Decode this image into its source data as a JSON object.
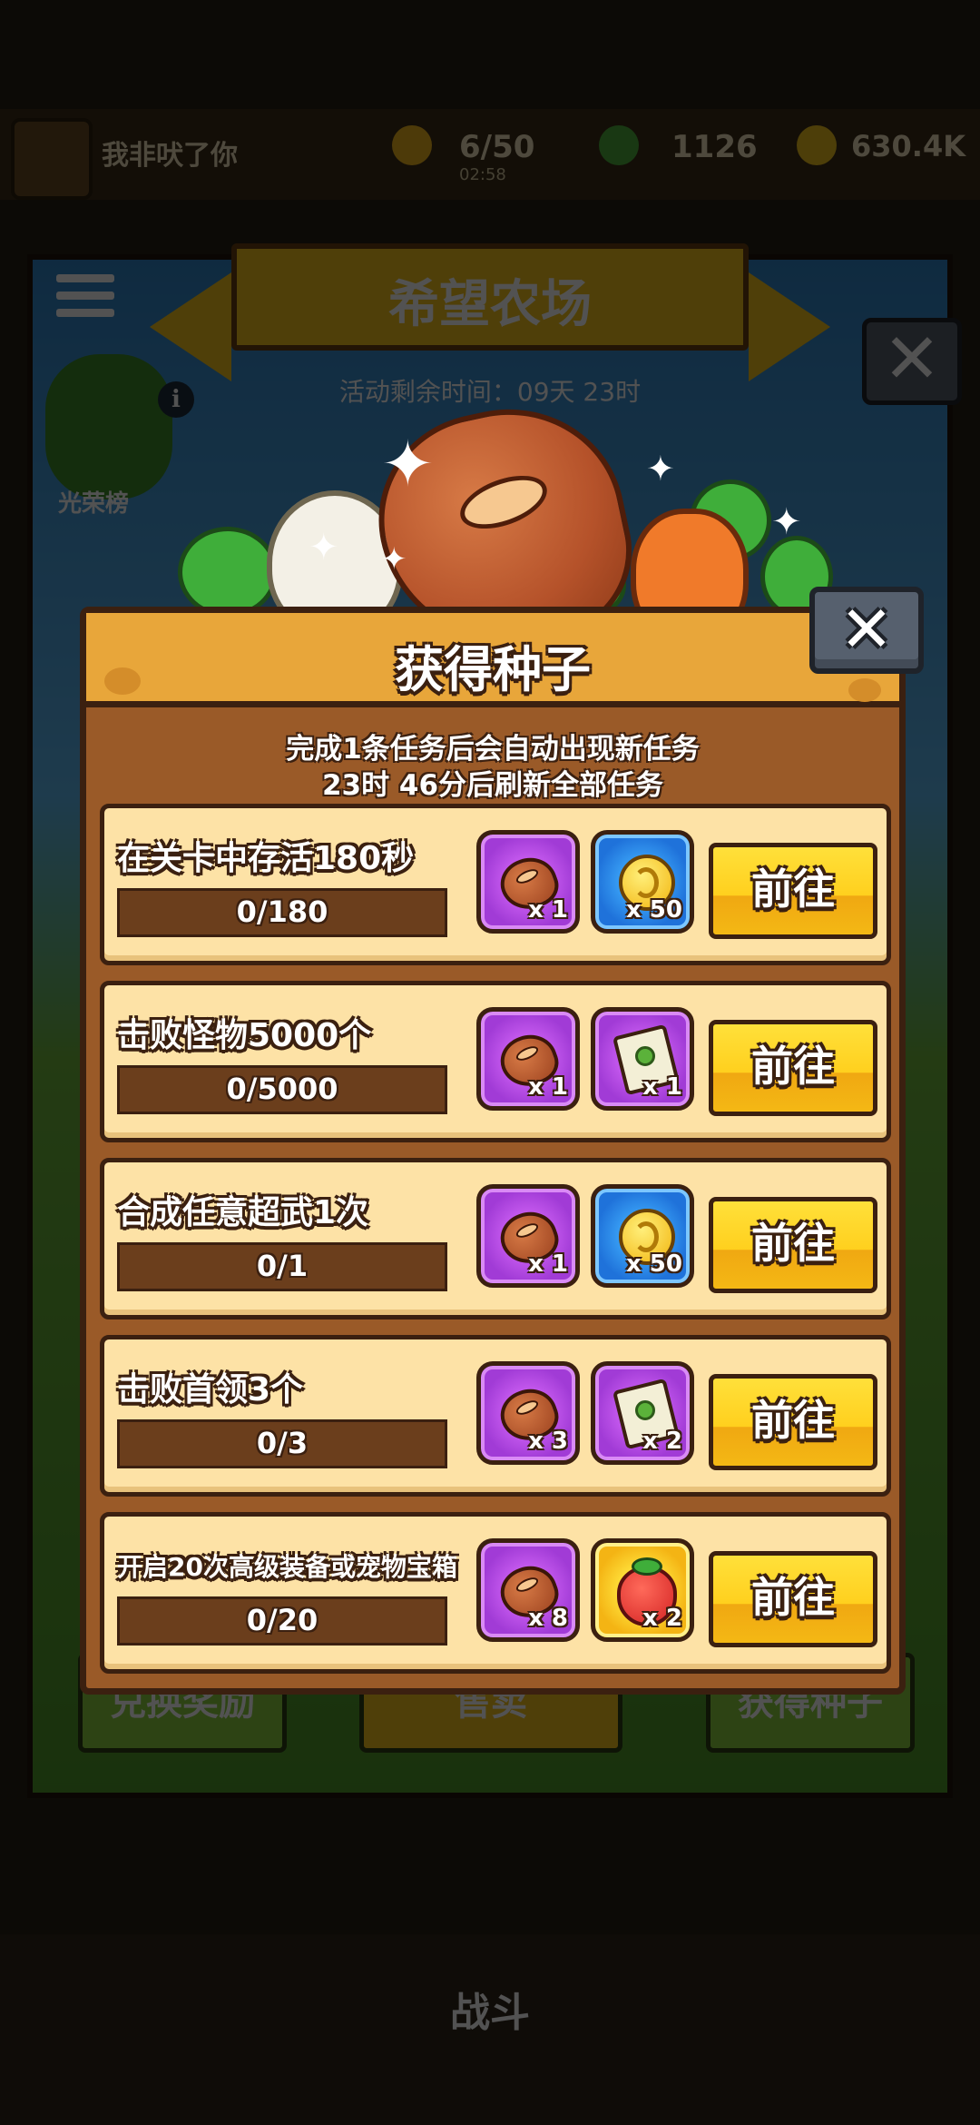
{
  "background": {
    "player_name": "我非吠了你",
    "stats": [
      {
        "value": "6/50",
        "sub": "02:58",
        "icon": "energy-icon"
      },
      {
        "value": "1126",
        "icon": "gem-icon"
      },
      {
        "value": "630.4K",
        "icon": "coin-icon"
      }
    ],
    "banner_title": "希望农场",
    "timer": "活动剩余时间：09天 23时",
    "rank_label": "光荣榜",
    "buttons": [
      "兑换奖励",
      "售卖",
      "获得种子"
    ],
    "nav_battle": "战斗"
  },
  "modal": {
    "title": "获得种子",
    "subtitle_line1": "完成1条任务后会自动出现新任务",
    "subtitle_line2": "23时 46分后刷新全部任务",
    "go_label": "前往",
    "tasks": [
      {
        "title": "在关卡中存活180秒",
        "progress_text": "0/180",
        "progress": 0,
        "rewards": [
          {
            "type": "seed-bean",
            "count": "x 1",
            "frame": "purple"
          },
          {
            "type": "coin",
            "count": "x 50",
            "frame": "blue"
          }
        ]
      },
      {
        "title": "击败怪物5000个",
        "progress_text": "0/5000",
        "progress": 0,
        "rewards": [
          {
            "type": "seed-bean",
            "count": "x 1",
            "frame": "purple"
          },
          {
            "type": "seed-packet",
            "count": "x 1",
            "frame": "purple"
          }
        ]
      },
      {
        "title": "合成任意超武1次",
        "progress_text": "0/1",
        "progress": 0,
        "rewards": [
          {
            "type": "seed-bean",
            "count": "x 1",
            "frame": "purple"
          },
          {
            "type": "coin",
            "count": "x 50",
            "frame": "blue"
          }
        ]
      },
      {
        "title": "击败首领3个",
        "progress_text": "0/3",
        "progress": 0,
        "rewards": [
          {
            "type": "seed-bean",
            "count": "x 3",
            "frame": "purple"
          },
          {
            "type": "seed-packet",
            "count": "x 2",
            "frame": "purple"
          }
        ]
      },
      {
        "title": "开启20次高级装备或宠物宝箱",
        "progress_text": "0/20",
        "progress": 0,
        "rewards": [
          {
            "type": "seed-bean",
            "count": "x 8",
            "frame": "purple"
          },
          {
            "type": "strawberry",
            "count": "x 2",
            "frame": "gold"
          }
        ]
      }
    ]
  },
  "colors": {
    "panel": "#9a5a28",
    "header": "#e8a63a",
    "card": "#fde2a6",
    "button": "#ffd01e",
    "outline": "#3b2010"
  }
}
